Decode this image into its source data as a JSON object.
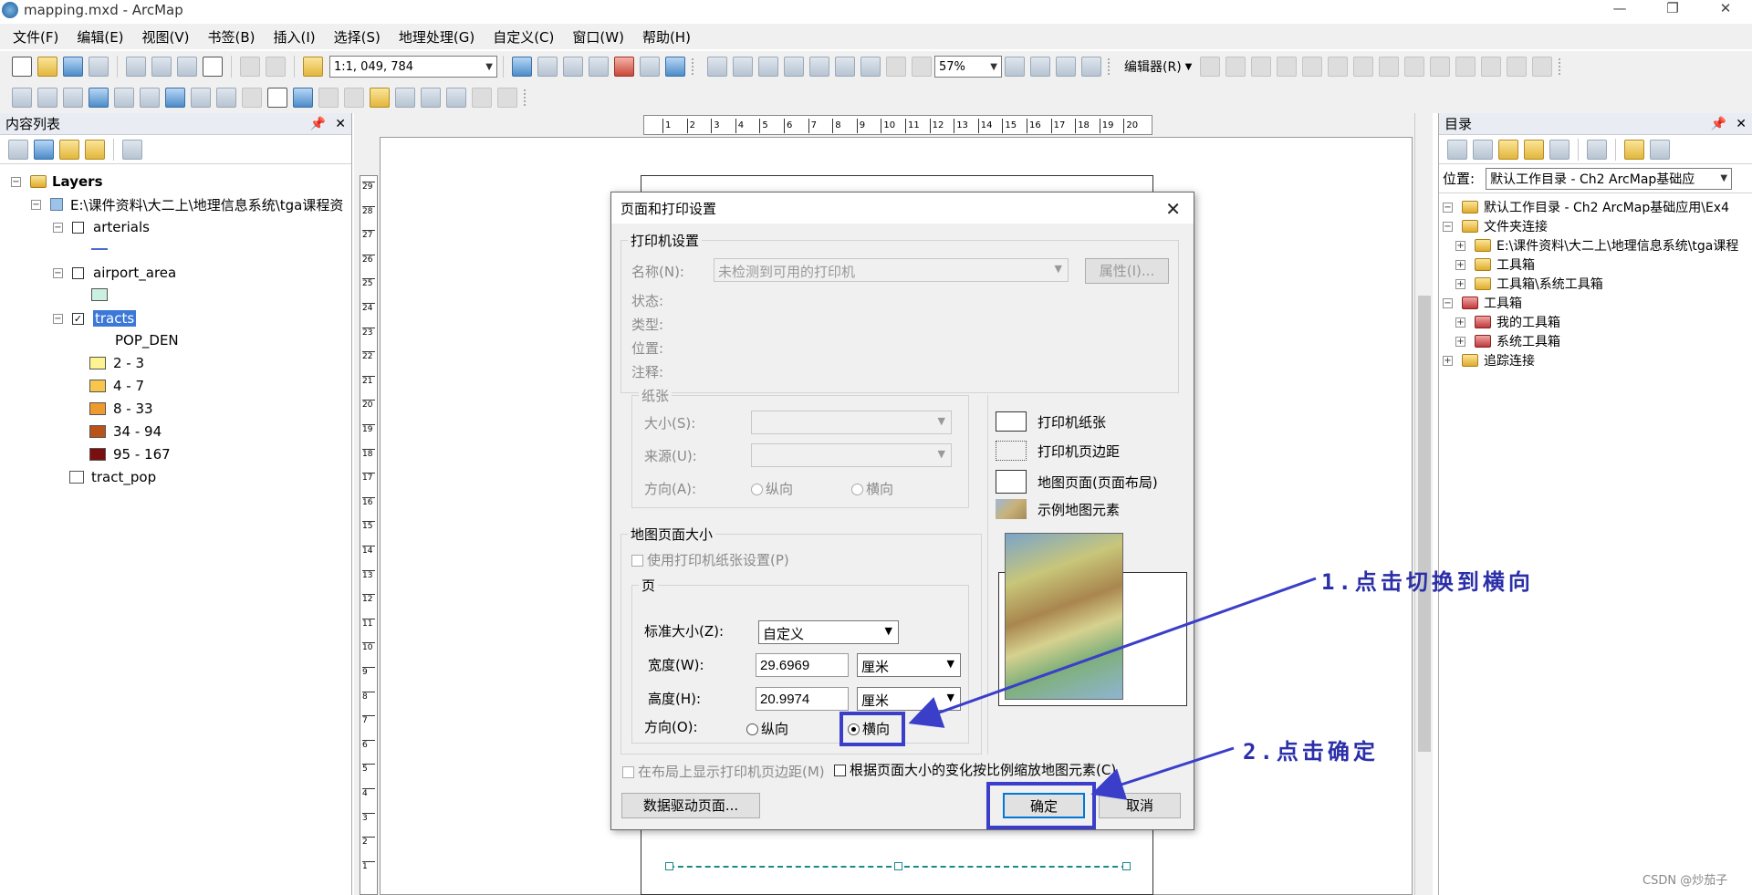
{
  "window": {
    "title": "mapping.mxd - ArcMap",
    "min": "—",
    "restore": "❐",
    "close": "✕"
  },
  "menu": [
    "文件(F)",
    "编辑(E)",
    "视图(V)",
    "书签(B)",
    "插入(I)",
    "选择(S)",
    "地理处理(G)",
    "自定义(C)",
    "窗口(W)",
    "帮助(H)"
  ],
  "toolbar": {
    "scale": "1:1, 049, 784",
    "zoom": "57%",
    "editor": "编辑器(R)"
  },
  "toc": {
    "title": "内容列表",
    "root": "Layers",
    "path": "E:\\课件资料\\大二上\\地理信息系统\\tga课程资",
    "layers": [
      {
        "name": "arterials",
        "checked": false
      },
      {
        "name": "airport_area",
        "checked": false
      },
      {
        "name": "tracts",
        "checked": true
      }
    ],
    "field": "POP_DEN",
    "classes": [
      {
        "label": "2 - 3",
        "color": "#fdf391"
      },
      {
        "label": "4 - 7",
        "color": "#f9c64c"
      },
      {
        "label": "8 - 33",
        "color": "#ef9a2d"
      },
      {
        "label": "34 - 94",
        "color": "#b9531a"
      },
      {
        "label": "95 - 167",
        "color": "#7a0f0f"
      }
    ],
    "table": "tract_pop",
    "airport_color": "#c9f0e0"
  },
  "ruler": [
    "1",
    "2",
    "3",
    "4",
    "5",
    "6",
    "7",
    "8",
    "9",
    "10",
    "11",
    "12",
    "13",
    "14",
    "15",
    "16",
    "17",
    "18",
    "19",
    "20"
  ],
  "ruler_v": [
    "29",
    "28",
    "27",
    "26",
    "25",
    "24",
    "23",
    "22",
    "21",
    "20",
    "19",
    "18",
    "17",
    "16",
    "15",
    "14",
    "13",
    "12",
    "11",
    "10",
    "9",
    "8",
    "7",
    "6",
    "5",
    "4",
    "3",
    "2",
    "1"
  ],
  "catalog": {
    "title": "目录",
    "location_label": "位置:",
    "location_value": "默认工作目录 - Ch2  ArcMap基础应",
    "items": [
      {
        "label": "默认工作目录 - Ch2  ArcMap基础应用\\Ex4",
        "level": 0,
        "icon": "folder"
      },
      {
        "label": "文件夹连接",
        "level": 0,
        "icon": "folder"
      },
      {
        "label": "E:\\课件资料\\大二上\\地理信息系统\\tga课程",
        "level": 1,
        "icon": "folder"
      },
      {
        "label": "工具箱",
        "level": 1,
        "icon": "folder"
      },
      {
        "label": "工具箱\\系统工具箱",
        "level": 1,
        "icon": "folder"
      },
      {
        "label": "工具箱",
        "level": 0,
        "icon": "red"
      },
      {
        "label": "我的工具箱",
        "level": 1,
        "icon": "red"
      },
      {
        "label": "系统工具箱",
        "level": 1,
        "icon": "red"
      },
      {
        "label": "追踪连接",
        "level": 0,
        "icon": "folder"
      }
    ]
  },
  "dialog": {
    "title": "页面和打印设置",
    "printer": {
      "group": "打印机设置",
      "name_label": "名称(N):",
      "name_value": "未检测到可用的打印机",
      "props": "属性(I)...",
      "status": "状态:",
      "type": "类型:",
      "where": "位置:",
      "comment": "注释:"
    },
    "paper": {
      "group": "纸张",
      "size": "大小(S):",
      "source": "来源(U):",
      "orient": "方向(A):",
      "portrait": "纵向",
      "landscape": "横向"
    },
    "preview_legend": [
      "打印机纸张",
      "打印机页边距",
      "地图页面(页面布局)",
      "示例地图元素"
    ],
    "mapsize": {
      "group": "地图页面大小",
      "use_printer": "使用打印机纸张设置(P)",
      "page_group": "页",
      "std_label": "标准大小(Z):",
      "std_value": "自定义",
      "width_label": "宽度(W):",
      "width_value": "29.6969",
      "height_label": "高度(H):",
      "height_value": "20.9974",
      "unit": "厘米",
      "orient_label": "方向(O):",
      "portrait": "纵向",
      "landscape": "横向"
    },
    "show_margins": "在布局上显示打印机页边距(M)",
    "scale_elements": "根据页面大小的变化按比例缩放地图元素(C)",
    "ddp": "数据驱动页面...",
    "ok": "确定",
    "cancel": "取消"
  },
  "annotations": {
    "step1": "1.点击切换到横向",
    "step2": "2.点击确定",
    "color": "#3a3ec9"
  },
  "watermark": "CSDN @炒茄子"
}
